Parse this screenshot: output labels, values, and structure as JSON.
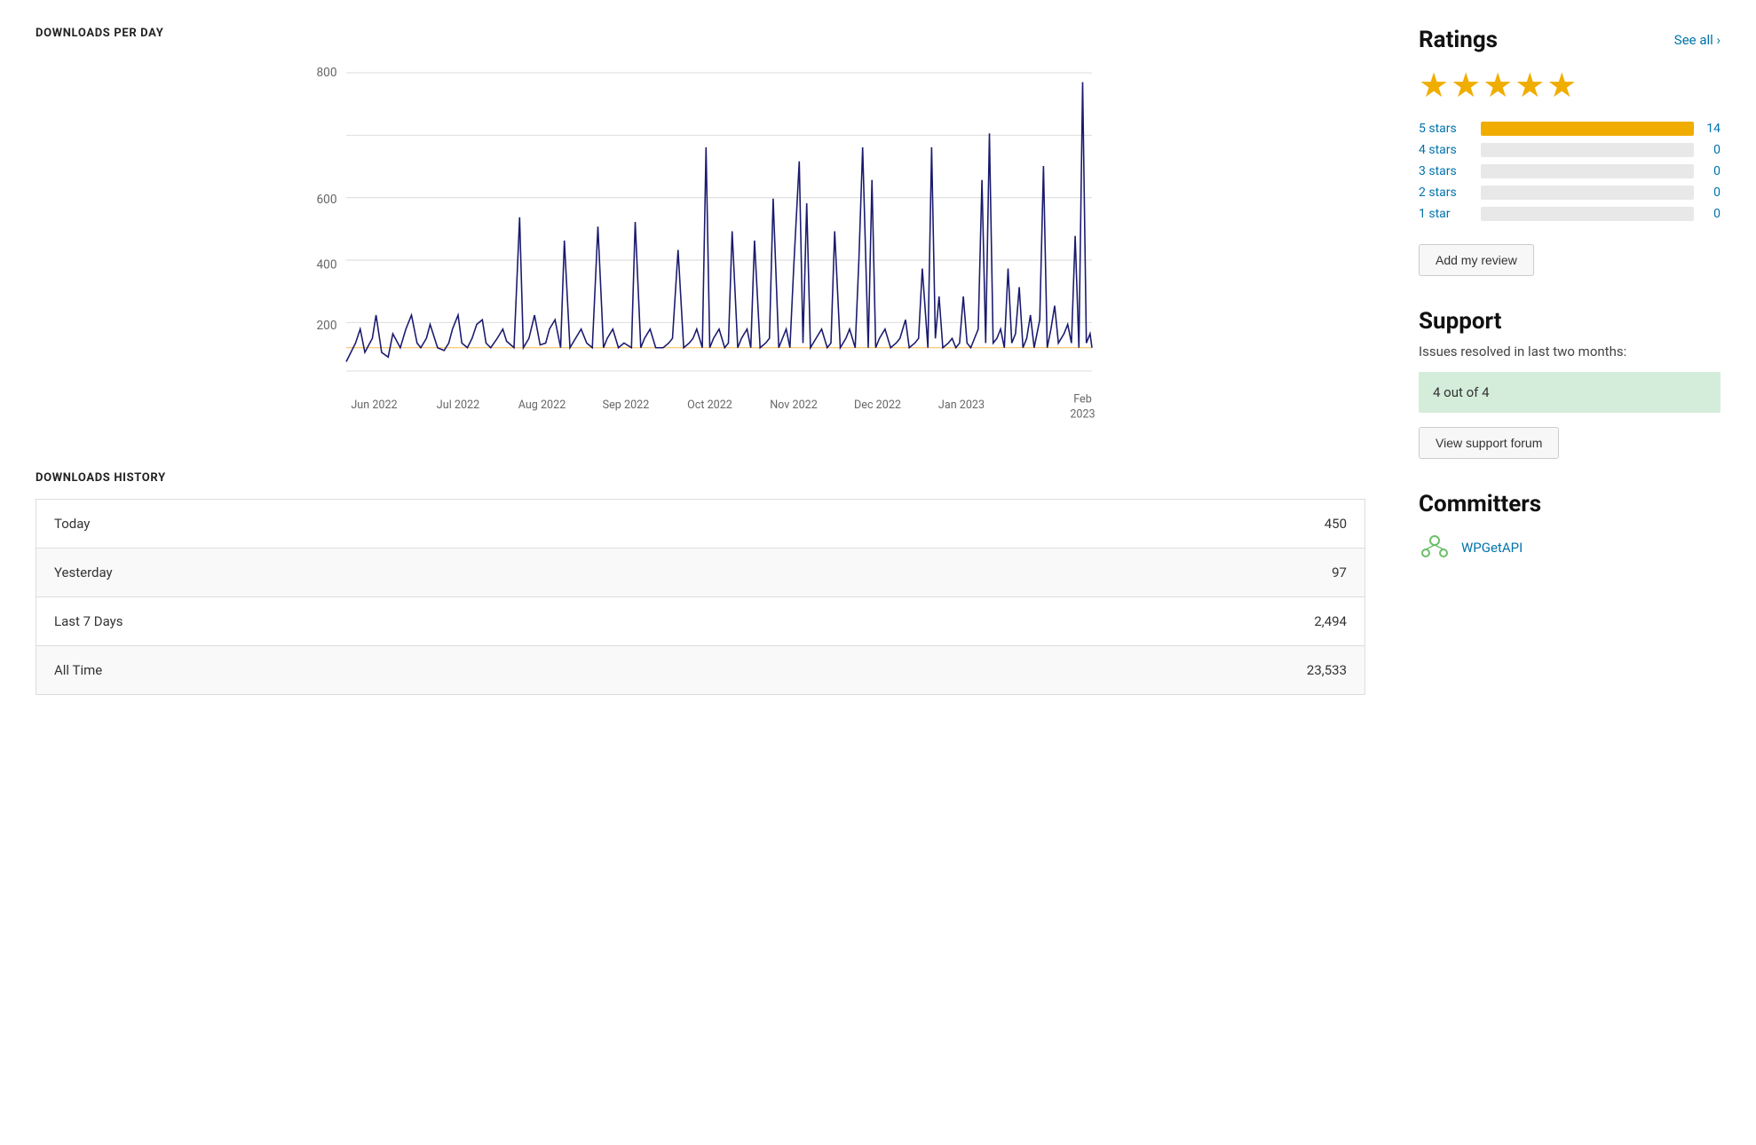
{
  "downloads_chart": {
    "title": "DOWNLOADS PER DAY",
    "y_labels": [
      "800",
      "600",
      "400",
      "200"
    ],
    "x_labels": [
      "Jun 2022",
      "Jul 2022",
      "Aug 2022",
      "Sep 2022",
      "Oct 2022",
      "Nov 2022",
      "Dec 2022",
      "Jan 2023",
      "Feb\n2023"
    ],
    "accent_color": "#1a1a6e",
    "avg_line_color": "#f0a000"
  },
  "downloads_history": {
    "title": "DOWNLOADS HISTORY",
    "rows": [
      {
        "label": "Today",
        "value": "450"
      },
      {
        "label": "Yesterday",
        "value": "97"
      },
      {
        "label": "Last 7 Days",
        "value": "2,494"
      },
      {
        "label": "All Time",
        "value": "23,533"
      }
    ]
  },
  "ratings": {
    "title": "Ratings",
    "see_all_label": "See all ›",
    "stars": "★★★★",
    "half_star": "★",
    "rows": [
      {
        "label": "5 stars",
        "count": "14",
        "pct": 100
      },
      {
        "label": "4 stars",
        "count": "0",
        "pct": 0
      },
      {
        "label": "3 stars",
        "count": "0",
        "pct": 0
      },
      {
        "label": "2 stars",
        "count": "0",
        "pct": 0
      },
      {
        "label": "1 star",
        "count": "0",
        "pct": 0
      }
    ],
    "add_review_label": "Add my review"
  },
  "support": {
    "title": "Support",
    "subtitle": "Issues resolved in last two months:",
    "resolved_text": "4 out of 4",
    "forum_button_label": "View support forum"
  },
  "committers": {
    "title": "Committers",
    "list": [
      {
        "name": "WPGetAPI"
      }
    ]
  }
}
